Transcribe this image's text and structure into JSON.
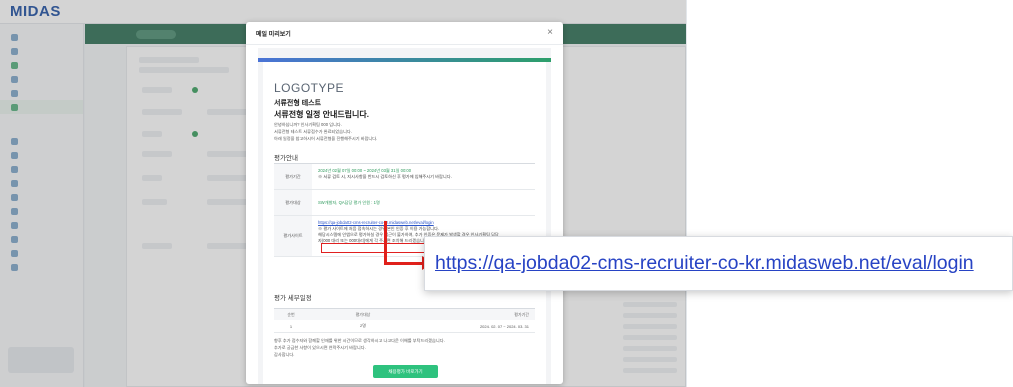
{
  "app": {
    "logo": "MIDAS",
    "breadcrumb": "",
    "topnav": [
      "",
      "",
      "",
      "",
      ""
    ]
  },
  "modal": {
    "title": "메일 미리보기",
    "close": "×",
    "logo_caption": "",
    "logo_text": "LOGOTYPE",
    "mail_title": "서류전형 테스트",
    "mail_subtitle": "서류전형 일정 안내드립니다.",
    "intro_lines": [
      "안녕하십니까? 인사기획팀 000 입니다.",
      "서류전형 테스트 서류접수가 완료되었습니다.",
      "아래 일정을 참고하시어 서류전형을 진행해주시기 바랍니다."
    ],
    "section_eval": "평가안내",
    "rows": [
      {
        "label": "평가기간",
        "line1": "2024년 02월 07일 00:00 ~ 2024년 03월 31일 00:00",
        "line2": "※ 서류 검토 시, 지시사항을 반드시 검토하신 후 평가에 임해주시기 바랍니다."
      },
      {
        "label": "평가대상",
        "line1": "SW개발자, QA담당 평가 인원 : 1명",
        "line2": ""
      },
      {
        "label": "평가사이트",
        "link": "https://qa-jobda02-cms-recruiter-co-kr.midasweb.net/eval/login",
        "line2": "※ 평가 사이트에 처음 접속하시는 경우 본인 인증 후 이용 가능합니다.",
        "line3": "해당시스템에 인앱으로 평가하실 경우 접근이 불가하여, 추가 인증은 문제가 발생할 경우 인사기획팀 담당",
        "line4": "자(000 대리 또는 000대리)에게 각 주시면 조치해 드리겠습니다."
      }
    ],
    "section_detail": "평가 세부일정",
    "detail_header": [
      "순번",
      "평가대상",
      "평가기간"
    ],
    "detail_row": [
      "1",
      "2명",
      "2024. 02. 07 ~ 2024. 03. 31"
    ],
    "footer_lines": [
      "향후 추가 접수자와 함께할 인재를 위한 시간이므로 생각하시고 나고다운 이해를 부탁드리겠습니다.",
      "추가로 궁금한 사항이 있으시면 연락주시기 바랍니다.",
      "감사합니다."
    ],
    "cta_label": "채용평가 바로가기"
  },
  "zoom": {
    "url": "https://qa-jobda02-cms-recruiter-co-kr.midasweb.net/eval/login"
  },
  "colors": {
    "brand": "#1e4fa3",
    "accent_green": "#2ec27e",
    "highlight_red": "#e02020",
    "link_blue": "#2743c4"
  }
}
